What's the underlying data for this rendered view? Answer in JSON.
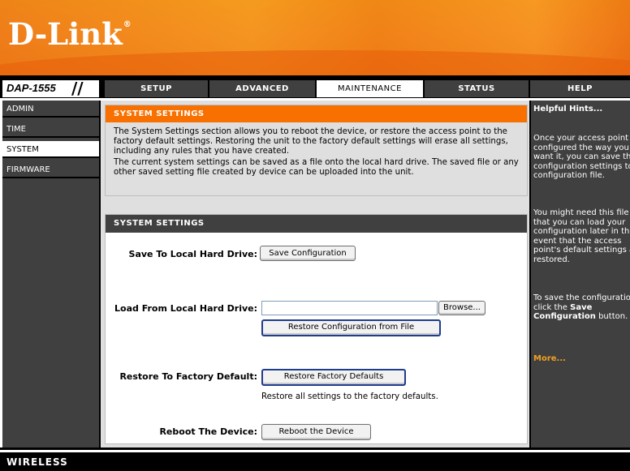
{
  "brand": {
    "logo": "D-Link",
    "model": "DAP-1555",
    "footer_label": "WIRELESS"
  },
  "nav": {
    "tabs": [
      {
        "label": "SETUP",
        "active": false
      },
      {
        "label": "ADVANCED",
        "active": false
      },
      {
        "label": "MAINTENANCE",
        "active": true
      },
      {
        "label": "STATUS",
        "active": false
      },
      {
        "label": "HELP",
        "active": false
      }
    ]
  },
  "sidebar": {
    "items": [
      {
        "label": "ADMIN",
        "active": false
      },
      {
        "label": "TIME",
        "active": false
      },
      {
        "label": "SYSTEM",
        "active": true
      },
      {
        "label": "FIRMWARE",
        "active": false
      }
    ]
  },
  "intro": {
    "title": "SYSTEM SETTINGS",
    "p1": "The System Settings section allows you to reboot the device, or restore the access point to the factory default settings. Restoring the unit to the factory default settings will erase all settings, including any rules that you have created.",
    "p2": "The current system settings can be saved as a file onto the local hard drive. The saved file or any other saved setting file created by device can be uploaded into the unit."
  },
  "settings": {
    "title": "SYSTEM SETTINGS",
    "save_label": "Save To Local Hard Drive:",
    "save_button": "Save Configuration",
    "load_label": "Load From Local Hard Drive:",
    "file_value": "",
    "browse_button": "Browse...",
    "restore_file_button": "Restore Configuration from File",
    "factory_label": "Restore To Factory Default:",
    "factory_button": "Restore Factory Defaults",
    "factory_note": "Restore all settings to the factory defaults.",
    "reboot_label": "Reboot The Device:",
    "reboot_button": "Reboot the Device"
  },
  "help": {
    "title": "Helpful Hints...",
    "p1": "Once your access point is configured the way you want it, you can save the configuration settings to a configuration file.",
    "p2": "You might need this file so that you can load your configuration later in the event that the access point's default settings are restored.",
    "p3_prefix": "To save the configuration, click the ",
    "p3_bold": "Save Configuration",
    "p3_suffix": " button.",
    "more": "More..."
  },
  "colors": {
    "accent_orange": "#f87000",
    "dark_gray": "#404040",
    "link_orange": "#f0a020"
  }
}
